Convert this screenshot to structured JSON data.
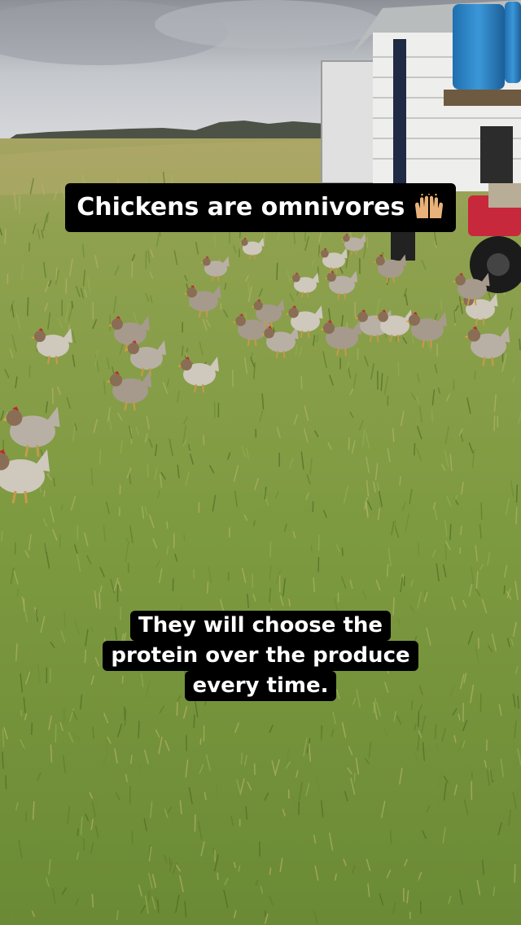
{
  "captions": {
    "top": "Chickens are omnivores",
    "top_emoji": "raising-hands-emoji",
    "bottom_lines": [
      "They will choose the",
      "protein over the produce",
      "every time."
    ]
  },
  "colors": {
    "sky": "#c9ccd1",
    "grass": "#7f9a45",
    "caption_bg": "#000000",
    "caption_text": "#ffffff",
    "barrel": "#2f86c9",
    "atv": "#c8283b"
  }
}
